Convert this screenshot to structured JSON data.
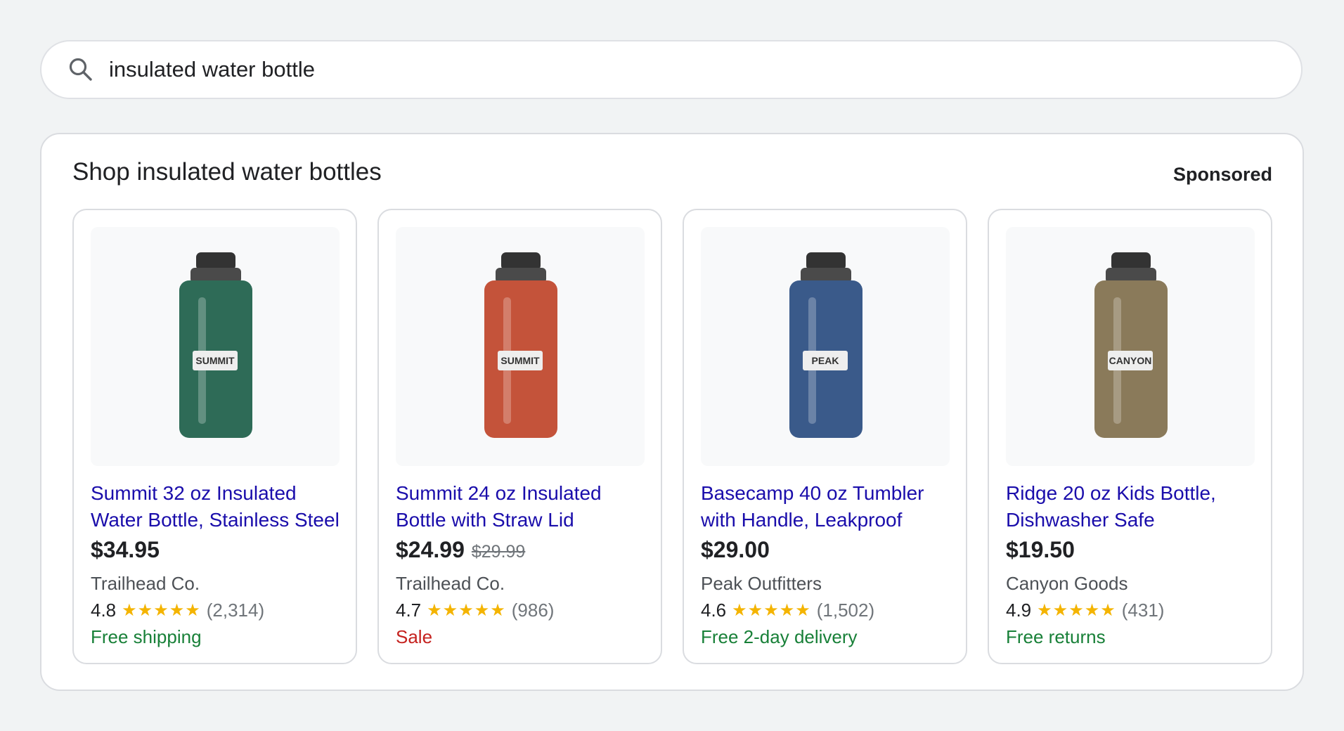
{
  "search": {
    "query": "insulated water bottle"
  },
  "panel": {
    "title": "Shop insulated water bottles",
    "sponsored_label": "Sponsored"
  },
  "products": [
    {
      "title": "Summit 32 oz Insulated Water Bottle, Stainless Steel",
      "price": "$34.95",
      "old_price": "",
      "merchant": "Trailhead Co.",
      "rating": "4.8",
      "stars": "★★★★★",
      "reviews": "(2,314)",
      "perk": "Free shipping",
      "perk_color": "green",
      "bottle_color": "#2e6b57",
      "bottle_label": "SUMMIT"
    },
    {
      "title": "Summit 24 oz Insulated Bottle with Straw Lid",
      "price": "$24.99",
      "old_price": "$29.99",
      "merchant": "Trailhead Co.",
      "rating": "4.7",
      "stars": "★★★★★",
      "reviews": "(986)",
      "perk": "Sale",
      "perk_color": "red",
      "bottle_color": "#c4533a",
      "bottle_label": "SUMMIT"
    },
    {
      "title": "Basecamp 40 oz Tumbler with Handle, Leakproof",
      "price": "$29.00",
      "old_price": "",
      "merchant": "Peak Outfitters",
      "rating": "4.6",
      "stars": "★★★★★",
      "reviews": "(1,502)",
      "perk": "Free 2-day delivery",
      "perk_color": "green",
      "bottle_color": "#3a5a8a",
      "bottle_label": "PEAK"
    },
    {
      "title": "Ridge 20 oz Kids Bottle, Dishwasher Safe",
      "price": "$19.50",
      "old_price": "",
      "merchant": "Canyon Goods",
      "rating": "4.9",
      "stars": "★★★★★",
      "reviews": "(431)",
      "perk": "Free returns",
      "perk_color": "green",
      "bottle_color": "#8a7a5a",
      "bottle_label": "CANYON"
    }
  ],
  "colors": {
    "link": "#1a0dab",
    "green": "#188038",
    "red": "#c5221f",
    "star": "#f4b400"
  }
}
